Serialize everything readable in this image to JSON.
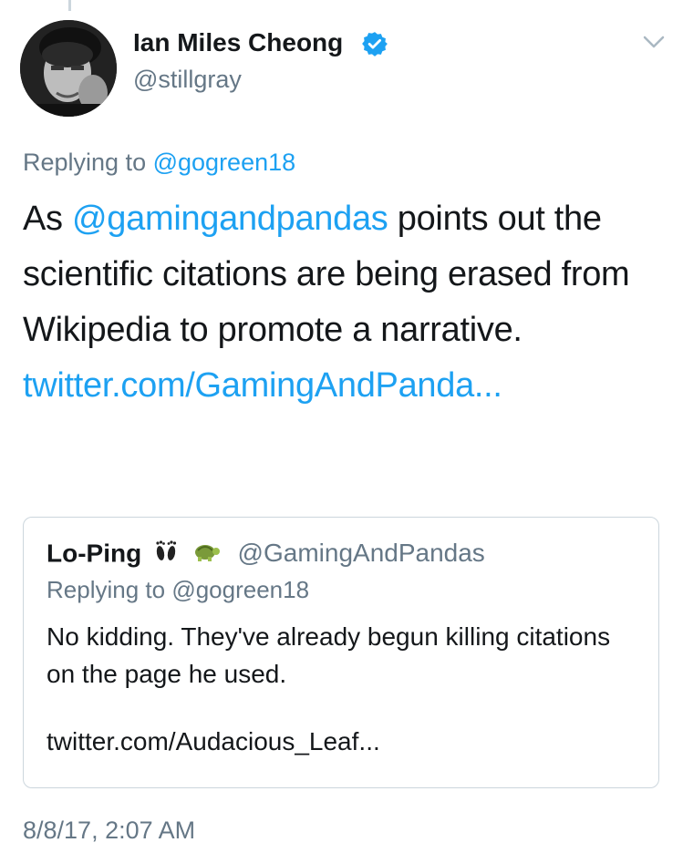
{
  "tweet": {
    "author": {
      "name": "Ian Miles Cheong",
      "handle": "@stillgray",
      "verified": true,
      "avatar_icon": "avatar-photo"
    },
    "menu_icon": "chevron-down-icon",
    "replying_prefix": "Replying to",
    "replying_to": "@gogreen18",
    "text": {
      "part1": "As ",
      "mention": "@gamingandpandas",
      "part2": " points out the scientific citations are being erased from Wikipedia to promote a narrative. ",
      "link": "twitter.com/GamingAndPanda..."
    },
    "timestamp": "8/8/17, 2:07 AM"
  },
  "quoted_tweet": {
    "name": "Lo-Ping",
    "name_emoji": [
      "footprints-emoji",
      "turtle-emoji"
    ],
    "handle": "@GamingAndPandas",
    "replying_prefix": "Replying to",
    "replying_to": "@gogreen18",
    "text": "No kidding. They've already begun killing citations on the page he used.",
    "link": "twitter.com/Audacious_Leaf..."
  },
  "colors": {
    "link": "#1da1f2",
    "secondary_text": "#657786",
    "primary_text": "#14171a",
    "border": "#ccd6dd"
  }
}
